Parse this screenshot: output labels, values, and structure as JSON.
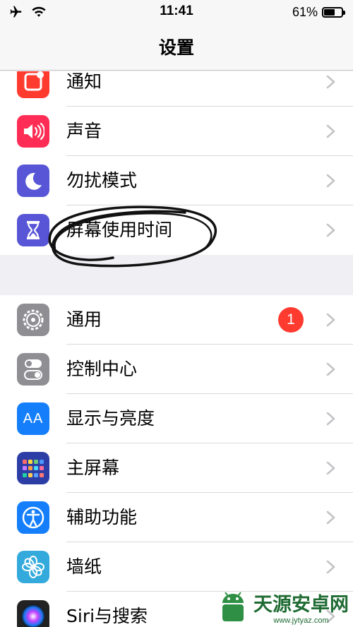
{
  "status_bar": {
    "time": "11:41",
    "battery_percent": "61%",
    "battery_level": 0.61,
    "left_icons": [
      "airplane-icon",
      "wifi-icon"
    ]
  },
  "nav": {
    "title": "设置"
  },
  "group1": [
    {
      "label": "通知",
      "icon": "notifications-icon",
      "color": "#ff3b30"
    },
    {
      "label": "声音",
      "icon": "sound-icon",
      "color": "#ff2d55"
    },
    {
      "label": "勿扰模式",
      "icon": "moon-icon",
      "color": "#5856d6"
    },
    {
      "label": "屏幕使用时间",
      "icon": "hourglass-icon",
      "color": "#5856d6"
    }
  ],
  "group2": [
    {
      "label": "通用",
      "icon": "gear-icon",
      "color": "#8e8e93",
      "badge": "1"
    },
    {
      "label": "控制中心",
      "icon": "toggles-icon",
      "color": "#8e8e93"
    },
    {
      "label": "显示与亮度",
      "icon": "aa-icon",
      "color": "#147efb",
      "icon_text": "AA"
    },
    {
      "label": "主屏幕",
      "icon": "home-screen-icon",
      "color": "#2c3ea6"
    },
    {
      "label": "辅助功能",
      "icon": "accessibility-icon",
      "color": "#147efb"
    },
    {
      "label": "墙纸",
      "icon": "wallpaper-flower-icon",
      "color": "#34aadc"
    },
    {
      "label": "Siri与搜索",
      "icon": "siri-icon",
      "color": "#222222"
    }
  ],
  "watermark": {
    "text": "天源安卓网",
    "url": "www.jytyaz.com"
  }
}
